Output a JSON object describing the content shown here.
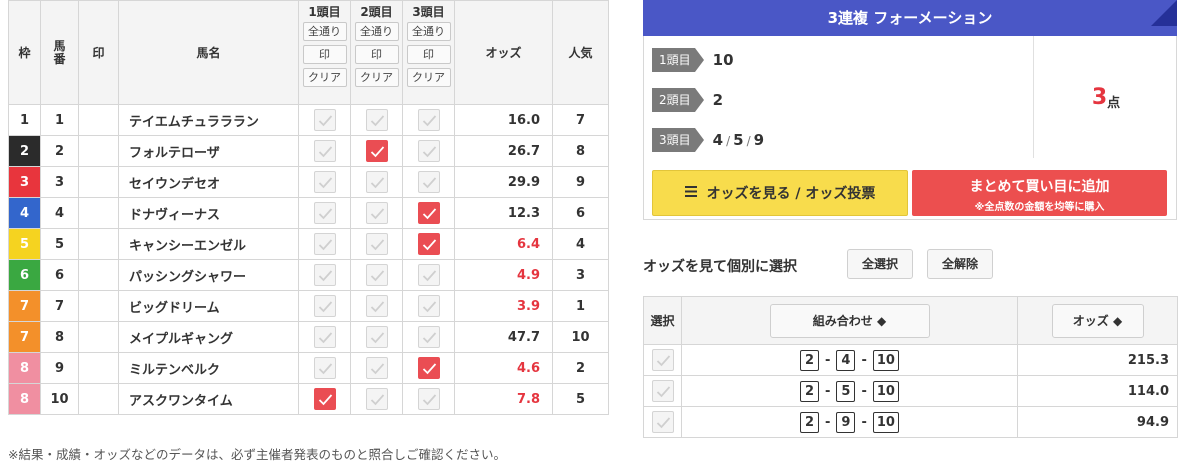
{
  "table": {
    "headers": {
      "waku": "枠",
      "umaban": "馬番",
      "mark": "印",
      "name": "馬名",
      "odds": "オッズ",
      "popularity": "人気"
    },
    "selection_columns": [
      {
        "title": "1頭目",
        "all": "全通り",
        "mark": "印",
        "clear": "クリア"
      },
      {
        "title": "2頭目",
        "all": "全通り",
        "mark": "印",
        "clear": "クリア"
      },
      {
        "title": "3頭目",
        "all": "全通り",
        "mark": "印",
        "clear": "クリア"
      }
    ],
    "rows": [
      {
        "waku": "1",
        "num": "1",
        "name": "テイエムチュラララン",
        "odds": "16.0",
        "pop": "7",
        "hot": false,
        "c1": false,
        "c2": false,
        "c3": false,
        "waku_bg": "#ffffff",
        "waku_fg": "#333333"
      },
      {
        "waku": "2",
        "num": "2",
        "name": "フォルテローザ",
        "odds": "26.7",
        "pop": "8",
        "hot": false,
        "c1": false,
        "c2": true,
        "c3": false,
        "waku_bg": "#2b2b2b",
        "waku_fg": "#ffffff"
      },
      {
        "waku": "3",
        "num": "3",
        "name": "セイウンデセオ",
        "odds": "29.9",
        "pop": "9",
        "hot": false,
        "c1": false,
        "c2": false,
        "c3": false,
        "waku_bg": "#e8353d",
        "waku_fg": "#ffffff"
      },
      {
        "waku": "4",
        "num": "4",
        "name": "ドナヴィーナス",
        "odds": "12.3",
        "pop": "6",
        "hot": false,
        "c1": false,
        "c2": false,
        "c3": true,
        "waku_bg": "#3366cc",
        "waku_fg": "#ffffff"
      },
      {
        "waku": "5",
        "num": "5",
        "name": "キャンシーエンゼル",
        "odds": "6.4",
        "pop": "4",
        "hot": true,
        "c1": false,
        "c2": false,
        "c3": true,
        "waku_bg": "#f5d320",
        "waku_fg": "#ffffff"
      },
      {
        "waku": "6",
        "num": "6",
        "name": "パッシングシャワー",
        "odds": "4.9",
        "pop": "3",
        "hot": true,
        "c1": false,
        "c2": false,
        "c3": false,
        "waku_bg": "#3aa841",
        "waku_fg": "#ffffff"
      },
      {
        "waku": "7",
        "num": "7",
        "name": "ビッグドリーム",
        "odds": "3.9",
        "pop": "1",
        "hot": true,
        "c1": false,
        "c2": false,
        "c3": false,
        "waku_bg": "#f3902a",
        "waku_fg": "#ffffff"
      },
      {
        "waku": "7",
        "num": "8",
        "name": "メイプルギャング",
        "odds": "47.7",
        "pop": "10",
        "hot": false,
        "c1": false,
        "c2": false,
        "c3": false,
        "waku_bg": "#f3902a",
        "waku_fg": "#ffffff"
      },
      {
        "waku": "8",
        "num": "9",
        "name": "ミルテンベルク",
        "odds": "4.6",
        "pop": "2",
        "hot": true,
        "c1": false,
        "c2": false,
        "c3": true,
        "waku_bg": "#f08fa1",
        "waku_fg": "#ffffff"
      },
      {
        "waku": "8",
        "num": "10",
        "name": "アスクワンタイム",
        "odds": "7.8",
        "pop": "5",
        "hot": true,
        "c1": true,
        "c2": false,
        "c3": false,
        "waku_bg": "#f08fa1",
        "waku_fg": "#ffffff"
      }
    ]
  },
  "note": "※結果・成績・オッズなどのデータは、必ず主催者発表のものと照合しご確認ください。",
  "formation": {
    "title": "3連複 フォーメーション",
    "rows": [
      {
        "label": "1頭目",
        "values": [
          "10"
        ]
      },
      {
        "label": "2頭目",
        "values": [
          "2"
        ]
      },
      {
        "label": "3頭目",
        "values": [
          "4",
          "5",
          "9"
        ]
      }
    ],
    "separator": "/",
    "count": "3",
    "count_unit": "点",
    "odds_button": "オッズを見る / オッズ投票",
    "add_button": "まとめて買い目に追加",
    "add_button_sub": "※全点数の金額を均等に購入"
  },
  "picker": {
    "title": "オッズを見て個別に選択",
    "select_all": "全選択",
    "deselect_all": "全解除"
  },
  "combos": {
    "headers": {
      "select": "選択",
      "combination": "組み合わせ ◆",
      "odds": "オッズ ◆"
    },
    "dash": "-",
    "rows": [
      {
        "a": "2",
        "b": "4",
        "c": "10",
        "odds": "215.3"
      },
      {
        "a": "2",
        "b": "5",
        "c": "10",
        "odds": "114.0"
      },
      {
        "a": "2",
        "b": "9",
        "c": "10",
        "odds": "94.9"
      }
    ]
  },
  "colors": {
    "accent_red": "#e5353f",
    "header_blue": "#4a57c6",
    "odds_yellow": "#f8dc4c"
  }
}
